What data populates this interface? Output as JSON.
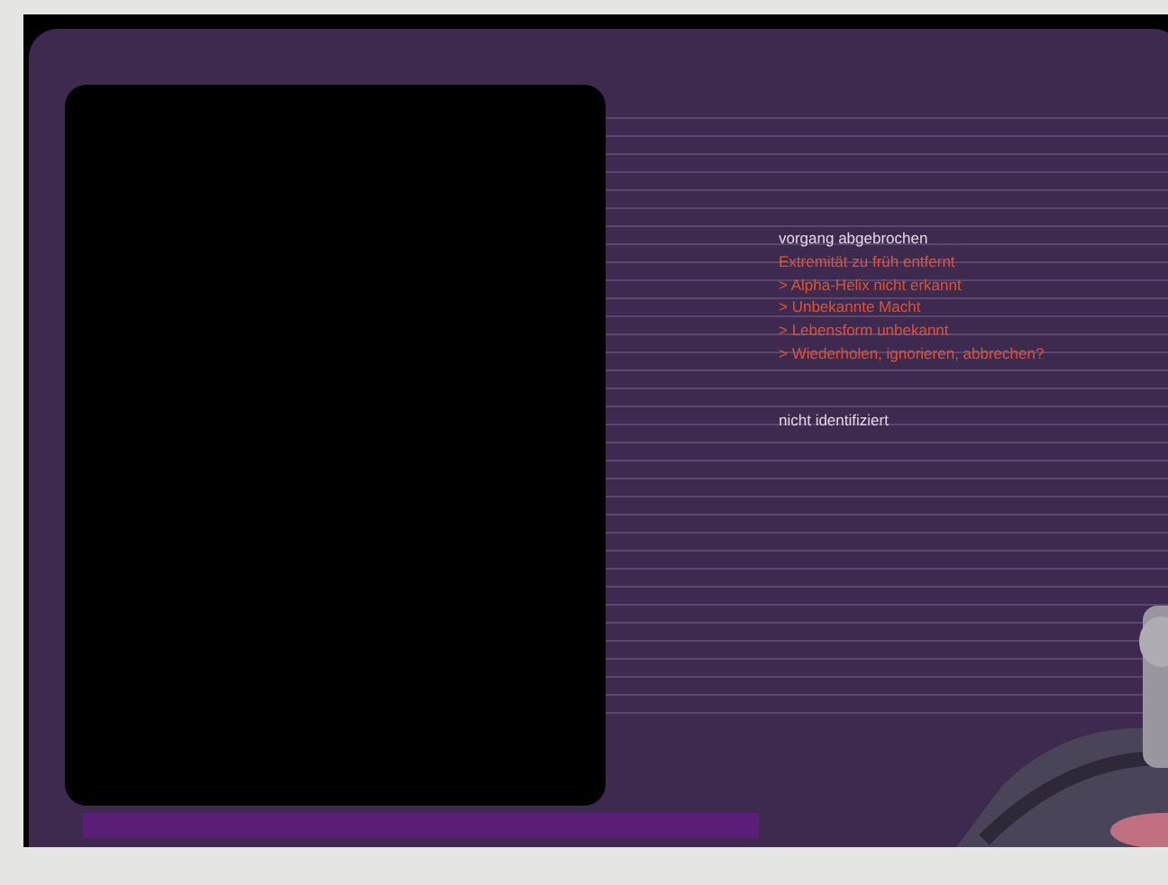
{
  "messages": [
    {
      "kind": "status",
      "text": "vorgang abgebrochen"
    },
    {
      "kind": "error",
      "text": "Extremität zu früh entfernt"
    },
    {
      "kind": "error",
      "text": "> Alpha-Helix nicht erkannt"
    },
    {
      "kind": "error",
      "text": "> Unbekannte Macht"
    },
    {
      "kind": "error",
      "text": "> Lebensform unbekannt"
    },
    {
      "kind": "error",
      "text": "> Wiederholen, ignorieren, abbrechen?"
    },
    {
      "kind": "gap"
    },
    {
      "kind": "status",
      "text": "nicht identifiziert"
    }
  ]
}
